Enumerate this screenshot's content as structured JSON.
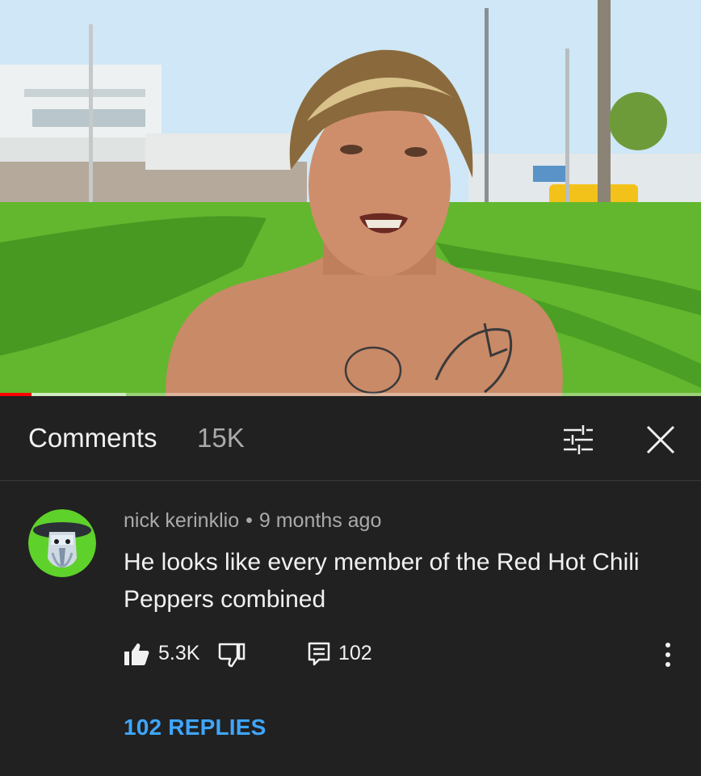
{
  "video": {
    "progress_fraction": 0.045,
    "buffered_fraction": 0.18
  },
  "comments_header": {
    "title": "Comments",
    "count": "15K"
  },
  "comment": {
    "author": "nick kerinklio",
    "separator": "•",
    "time": "9 months ago",
    "text": "He looks like every member of the Red Hot Chili Peppers combined",
    "likes": "5.3K",
    "reply_count": "102",
    "replies_link": "102 REPLIES"
  },
  "icons": {
    "sort": "sort-filter-icon",
    "close": "close-icon",
    "like": "thumbs-up-icon",
    "dislike": "thumbs-down-icon",
    "reply": "reply-comment-icon",
    "more": "more-vertical-icon"
  },
  "colors": {
    "background": "#212121",
    "primary_text": "#f1f1f1",
    "secondary_text": "#aaaaaa",
    "link": "#3ea6ff",
    "progress": "#ff0000",
    "avatar_ring": "#5fd12b"
  }
}
